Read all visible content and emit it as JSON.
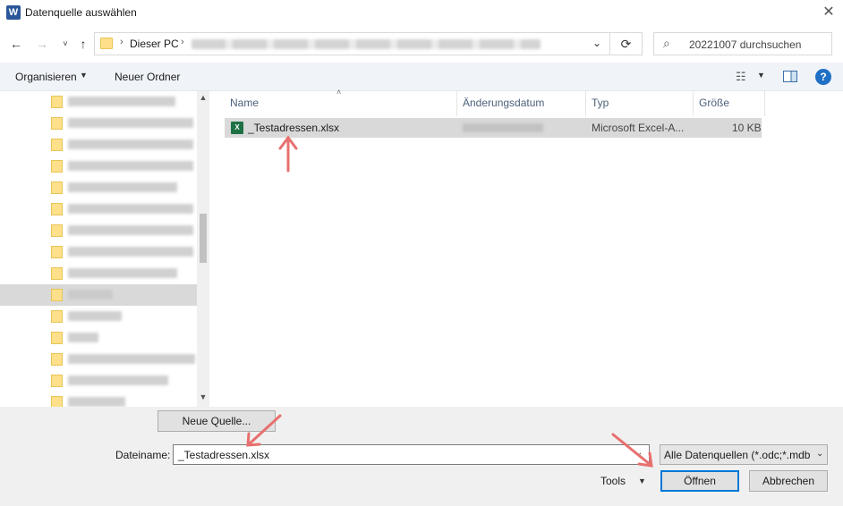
{
  "window": {
    "app_icon": "W",
    "title": "Datenquelle auswählen",
    "close_icon": "✕"
  },
  "navigation": {
    "back_icon": "←",
    "forward_icon": "→",
    "recent_icon": "˅",
    "up_icon": "↑",
    "address": {
      "separator": "›",
      "this_pc": "Dieser PC",
      "dropdown_icon": "⌄"
    },
    "refresh_icon": "⟳",
    "search": {
      "icon": "⌕",
      "placeholder": "20221007 durchsuchen"
    }
  },
  "toolbar": {
    "organize_label": "Organisieren",
    "organize_arrow": "▼",
    "new_folder_label": "Neuer Ordner",
    "view_icon": "☷",
    "view_arrow": "▼",
    "help_icon": "?"
  },
  "tree": {
    "scroll_up_icon": "▲",
    "scroll_down_icon": "▼"
  },
  "file_list": {
    "columns": [
      "Name",
      "Änderungsdatum",
      "Typ",
      "Größe"
    ],
    "sort_icon": "˄",
    "files": [
      {
        "icon": "X",
        "name": "_Testadressen.xlsx",
        "type": "Microsoft Excel-A...",
        "size": "10 KB"
      }
    ]
  },
  "dialog": {
    "new_source_label": "Neue Quelle...",
    "filename_label": "Dateiname:",
    "filename_value": "_Testadressen.xlsx",
    "filename_dropdown_icon": "⌄",
    "filter_value": "Alle Datenquellen (*.odc;*.mdb",
    "filter_dropdown_icon": "⌄",
    "tools_label": "Tools",
    "tools_arrow": "▼",
    "open_label": "Öffnen",
    "cancel_label": "Abbrechen"
  },
  "colors": {
    "accent": "#0078d7",
    "selection": "#d9d9d9",
    "annotation_arrow": "#e8706f",
    "folder": "#ffe08a"
  }
}
